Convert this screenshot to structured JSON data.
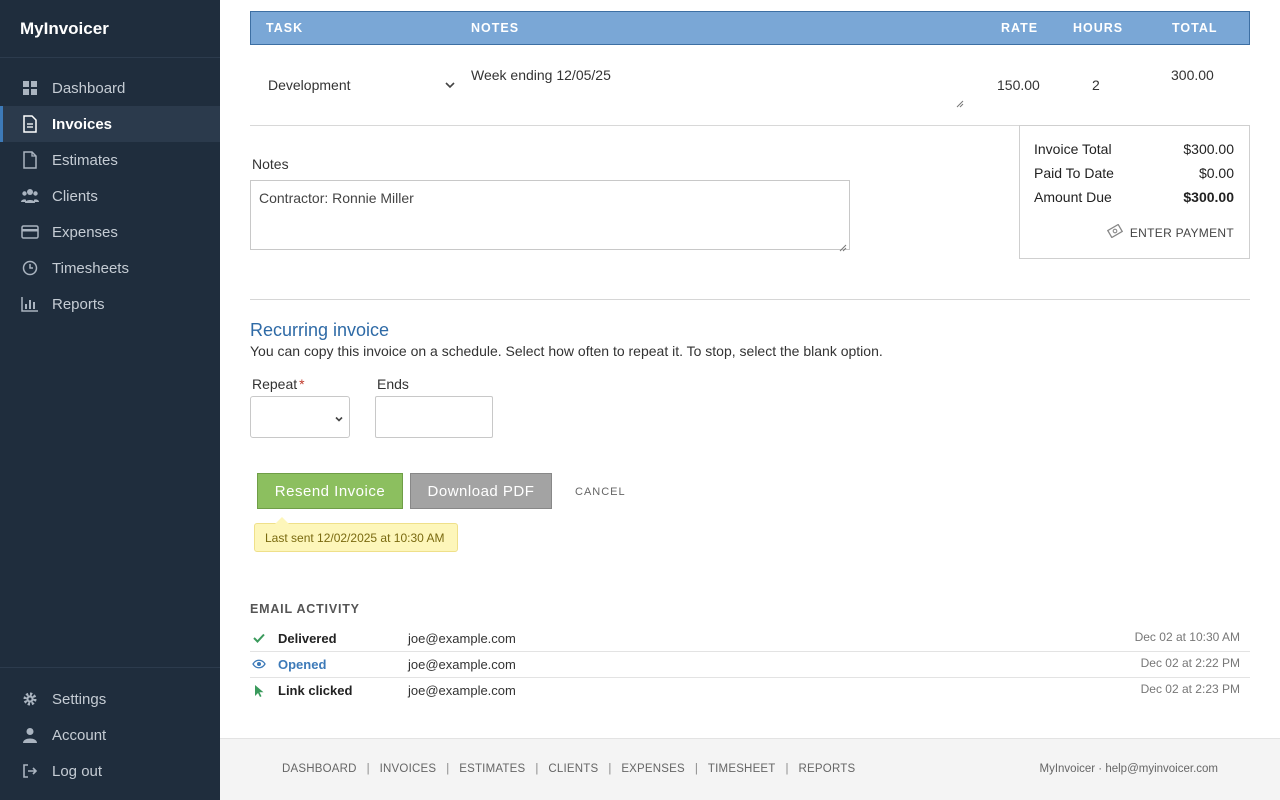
{
  "sidebar": {
    "brand": "MyInvoicer",
    "items": [
      {
        "label": "Dashboard",
        "icon": "dashboard-icon"
      },
      {
        "label": "Invoices",
        "icon": "document-icon",
        "active": true
      },
      {
        "label": "Estimates",
        "icon": "file-icon"
      },
      {
        "label": "Clients",
        "icon": "users-icon"
      },
      {
        "label": "Expenses",
        "icon": "credit-card-icon"
      },
      {
        "label": "Timesheets",
        "icon": "clock-icon"
      },
      {
        "label": "Reports",
        "icon": "bar-chart-icon"
      }
    ],
    "bottom_items": [
      {
        "label": "Settings",
        "icon": "gear-icon"
      },
      {
        "label": "Account",
        "icon": "user-icon"
      },
      {
        "label": "Log out",
        "icon": "logout-icon"
      }
    ]
  },
  "table": {
    "headers": {
      "task": "TASK",
      "notes": "NOTES",
      "rate": "RATE",
      "hours": "HOURS",
      "total": "TOTAL"
    },
    "rows": [
      {
        "task": "Development",
        "notes": "Week ending 12/05/25",
        "rate": "150.00",
        "hours": "2",
        "total": "300.00"
      }
    ]
  },
  "notes": {
    "label": "Notes",
    "value": "Contractor: Ronnie Miller"
  },
  "totals": {
    "invoice_total_label": "Invoice Total",
    "invoice_total": "$300.00",
    "paid_label": "Paid To Date",
    "paid": "$0.00",
    "due_label": "Amount Due",
    "due": "$300.00",
    "enter_payment": "ENTER PAYMENT"
  },
  "recurring": {
    "title": "Recurring invoice",
    "description": "You can copy this invoice on a schedule. Select how often to repeat it. To stop, select the blank option.",
    "repeat_label": "Repeat",
    "required_mark": "*",
    "repeat_value": "",
    "ends_label": "Ends",
    "ends_value": ""
  },
  "actions": {
    "resend": "Resend Invoice",
    "download": "Download PDF",
    "cancel": "CANCEL",
    "last_sent": "Last sent 12/02/2025 at 10:30 AM"
  },
  "email_activity": {
    "title": "EMAIL ACTIVITY",
    "rows": [
      {
        "status": "Delivered",
        "email": "joe@example.com",
        "time": "Dec 02 at 10:30 AM",
        "icon": "check-icon"
      },
      {
        "status": "Opened",
        "email": "joe@example.com",
        "time": "Dec 02 at 2:22 PM",
        "icon": "eye-icon"
      },
      {
        "status": "Link clicked",
        "email": "joe@example.com",
        "time": "Dec 02 at 2:23 PM",
        "icon": "cursor-icon"
      }
    ]
  },
  "footer": {
    "links": [
      "DASHBOARD",
      "INVOICES",
      "ESTIMATES",
      "CLIENTS",
      "EXPENSES",
      "TIMESHEET",
      "REPORTS"
    ],
    "separator": "|",
    "right": "MyInvoicer · help@myinvoicer.com"
  },
  "colors": {
    "sidebar_bg": "#1f2d3d",
    "table_header": "#7aa7d6",
    "accent_blue": "#2e6aa6",
    "resend_green": "#8cbf5f",
    "pdf_gray": "#a3a3a3",
    "tooltip_yellow": "#fdf6ba"
  }
}
